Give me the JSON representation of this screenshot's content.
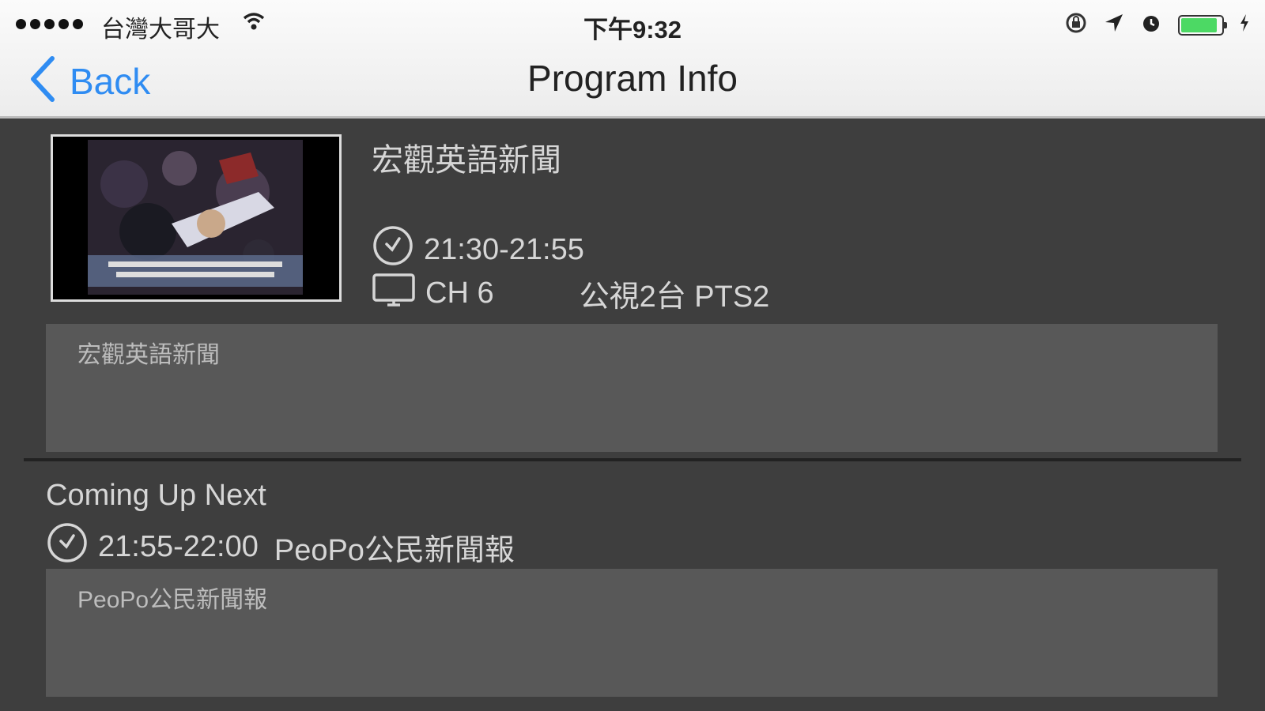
{
  "status_bar": {
    "carrier": "台灣大哥大",
    "time": "下午9:32",
    "battery_level": 0.9,
    "battery_color": "#4cd964"
  },
  "nav": {
    "back_label": "Back",
    "title": "Program Info",
    "accent_color": "#2f8cf2"
  },
  "program": {
    "title": "宏觀英語新聞",
    "time_range": "21:30-21:55",
    "channel": "CH 6",
    "station": "公視2台 PTS2",
    "description": "宏觀英語新聞"
  },
  "coming_up": {
    "heading": "Coming Up Next",
    "time_range": "21:55-22:00",
    "title": "PeoPo公民新聞報",
    "description": "PeoPo公民新聞報"
  }
}
